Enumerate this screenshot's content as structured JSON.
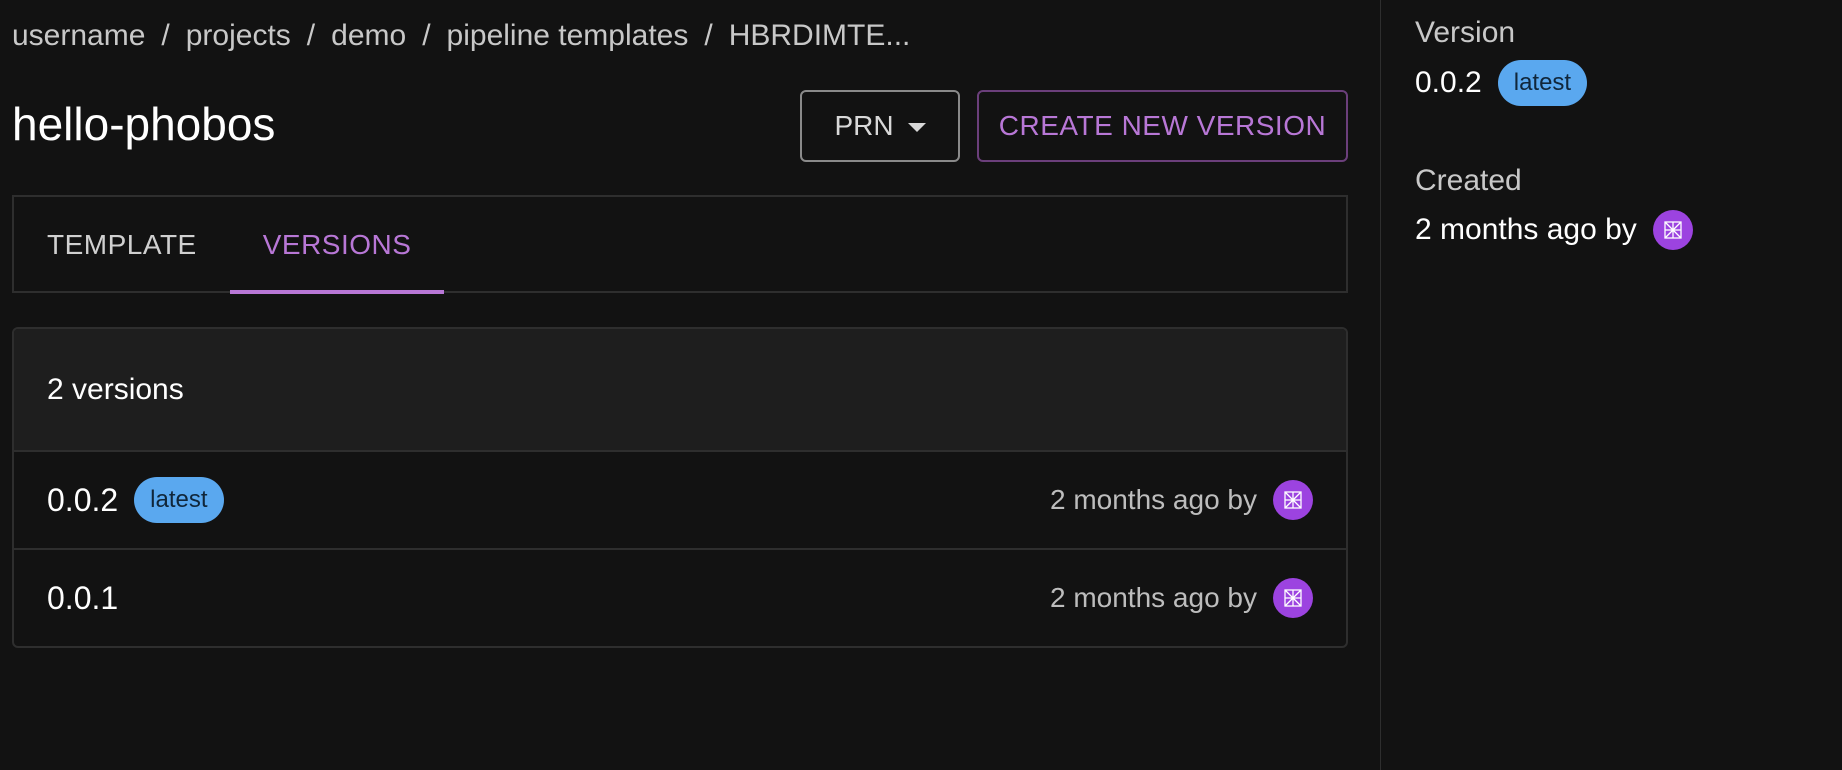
{
  "breadcrumb": {
    "items": [
      "username",
      "projects",
      "demo",
      "pipeline templates",
      "HBRDIMTE..."
    ],
    "separator": "/"
  },
  "title": "hello-phobos",
  "actions": {
    "prn_label": "PRN",
    "create_label": "CREATE NEW VERSION"
  },
  "tabs": [
    {
      "label": "TEMPLATE",
      "active": false
    },
    {
      "label": "VERSIONS",
      "active": true
    }
  ],
  "versions": {
    "count_label": "2 versions",
    "rows": [
      {
        "version": "0.0.2",
        "badge": "latest",
        "created": "2 months ago by"
      },
      {
        "version": "0.0.1",
        "badge": "",
        "created": "2 months ago by"
      }
    ]
  },
  "sidebar": {
    "version_label": "Version",
    "version_value": "0.0.2",
    "version_badge": "latest",
    "created_label": "Created",
    "created_value": "2 months ago by"
  },
  "colors": {
    "background": "#121212",
    "accent": "#b877d6",
    "badge": "#5aa8ef",
    "avatar": "#9c43e0",
    "border": "#2e2e2e"
  },
  "icons": {
    "dropdown": "chevron-down-icon",
    "avatar": "user-avatar-icon"
  }
}
